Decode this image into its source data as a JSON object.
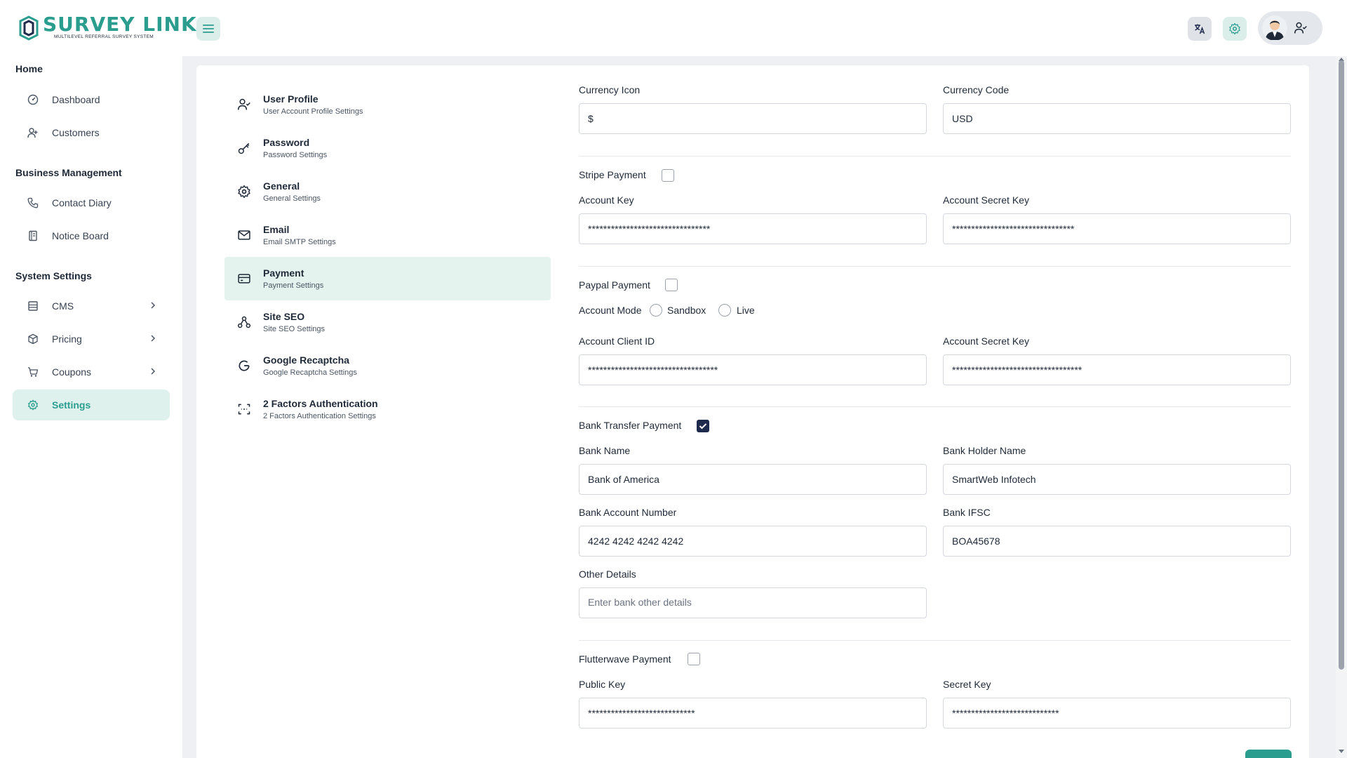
{
  "brand": {
    "title": "SURVEY LINK",
    "subtitle": "MULTILEVEL REFERRAL SURVEY SYSTEM",
    "accent": "#2a9d8f"
  },
  "header": {
    "menu_icon": "hamburger-icon",
    "translate_icon": "translate-icon",
    "settings_icon": "gear-icon",
    "user_icon": "user-check-icon"
  },
  "sidebar": {
    "sections": [
      {
        "heading": "Home",
        "items": [
          {
            "label": "Dashboard",
            "icon": "gauge-icon"
          },
          {
            "label": "Customers",
            "icon": "user-plus-icon"
          }
        ]
      },
      {
        "heading": "Business Management",
        "items": [
          {
            "label": "Contact Diary",
            "icon": "phone-icon"
          },
          {
            "label": "Notice Board",
            "icon": "notebook-icon"
          }
        ]
      },
      {
        "heading": "System Settings",
        "items": [
          {
            "label": "CMS",
            "icon": "layout-icon"
          },
          {
            "label": "Pricing",
            "icon": "package-icon"
          },
          {
            "label": "Coupons",
            "icon": "cart-icon"
          },
          {
            "label": "Settings",
            "icon": "gear-icon",
            "active": true
          }
        ]
      }
    ]
  },
  "settings_menu": [
    {
      "title": "User Profile",
      "subtitle": "User Account Profile Settings",
      "icon": "user-check-icon"
    },
    {
      "title": "Password",
      "subtitle": "Password Settings",
      "icon": "key-icon"
    },
    {
      "title": "General",
      "subtitle": "General Settings",
      "icon": "gear-icon"
    },
    {
      "title": "Email",
      "subtitle": "Email SMTP Settings",
      "icon": "mail-icon"
    },
    {
      "title": "Payment",
      "subtitle": "Payment Settings",
      "icon": "credit-card-icon",
      "active": true
    },
    {
      "title": "Site SEO",
      "subtitle": "Site SEO Settings",
      "icon": "network-icon"
    },
    {
      "title": "Google Recaptcha",
      "subtitle": "Google Recaptcha Settings",
      "icon": "google-icon"
    },
    {
      "title": "2 Factors Authentication",
      "subtitle": "2 Factors Authentication Settings",
      "icon": "scan-icon"
    }
  ],
  "payment": {
    "currency_icon": {
      "label": "Currency Icon",
      "value": "$"
    },
    "currency_code": {
      "label": "Currency Code",
      "value": "USD"
    },
    "stripe": {
      "label": "Stripe Payment",
      "enabled": false,
      "account_key": {
        "label": "Account Key",
        "value": "********************************"
      },
      "secret_key": {
        "label": "Account Secret Key",
        "value": "********************************"
      }
    },
    "paypal": {
      "label": "Paypal Payment",
      "enabled": false,
      "mode_label": "Account Mode",
      "mode_sandbox": "Sandbox",
      "mode_live": "Live",
      "client_id": {
        "label": "Account Client ID",
        "value": "**********************************"
      },
      "secret_key": {
        "label": "Account Secret Key",
        "value": "**********************************"
      }
    },
    "bank": {
      "label": "Bank Transfer Payment",
      "enabled": true,
      "bank_name": {
        "label": "Bank Name",
        "value": "Bank of America"
      },
      "holder_name": {
        "label": "Bank Holder Name",
        "value": "SmartWeb Infotech"
      },
      "account_number": {
        "label": "Bank Account Number",
        "value": "4242 4242 4242 4242"
      },
      "ifsc": {
        "label": "Bank IFSC",
        "value": "BOA45678"
      },
      "other": {
        "label": "Other Details",
        "placeholder": "Enter bank other details"
      }
    },
    "flutterwave": {
      "label": "Flutterwave Payment",
      "enabled": false,
      "public_key": {
        "label": "Public Key",
        "value": "****************************"
      },
      "secret_key": {
        "label": "Secret Key",
        "value": "****************************"
      }
    }
  }
}
